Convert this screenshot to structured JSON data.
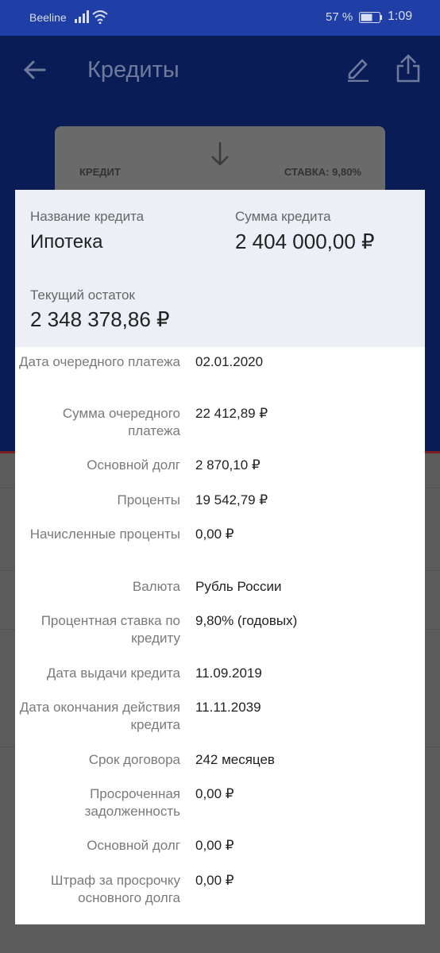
{
  "status": {
    "carrier": "Beeline",
    "battery": "57 %",
    "time": "1:09"
  },
  "appbar": {
    "title": "Кредиты"
  },
  "card": {
    "label": "КРЕДИТ",
    "rate": "СТАВКА: 9,80%"
  },
  "modal": {
    "name_label": "Название кредита",
    "name_value": "Ипотека",
    "sum_label": "Сумма кредита",
    "sum_value": "2 404 000,00 ₽",
    "balance_label": "Текущий остаток",
    "balance_value": "2 348 378,86 ₽",
    "rows": [
      {
        "k": "Дата очередного платежа",
        "v": "02.01.2020"
      },
      {
        "k": "Сумма очередного платежа",
        "v": "22 412,89 ₽"
      },
      {
        "k": "Основной долг",
        "v": "2 870,10 ₽"
      },
      {
        "k": "Проценты",
        "v": "19 542,79 ₽"
      },
      {
        "k": "Начисленные проценты",
        "v": "0,00 ₽"
      },
      {
        "k": "Валюта",
        "v": "Рубль России"
      },
      {
        "k": "Процентная ставка по кредиту",
        "v": "9,80% (годовых)"
      },
      {
        "k": "Дата выдачи кредита",
        "v": "11.09.2019"
      },
      {
        "k": "Дата окончания действия кредита",
        "v": "11.11.2039"
      },
      {
        "k": "Срок договора",
        "v": "242 месяцев"
      },
      {
        "k": "Просроченная задолженность",
        "v": "0,00 ₽"
      },
      {
        "k": "Основной долг",
        "v": "0,00 ₽"
      },
      {
        "k": "Штраф за просрочку основного долга",
        "v": "0,00 ₽"
      }
    ]
  }
}
